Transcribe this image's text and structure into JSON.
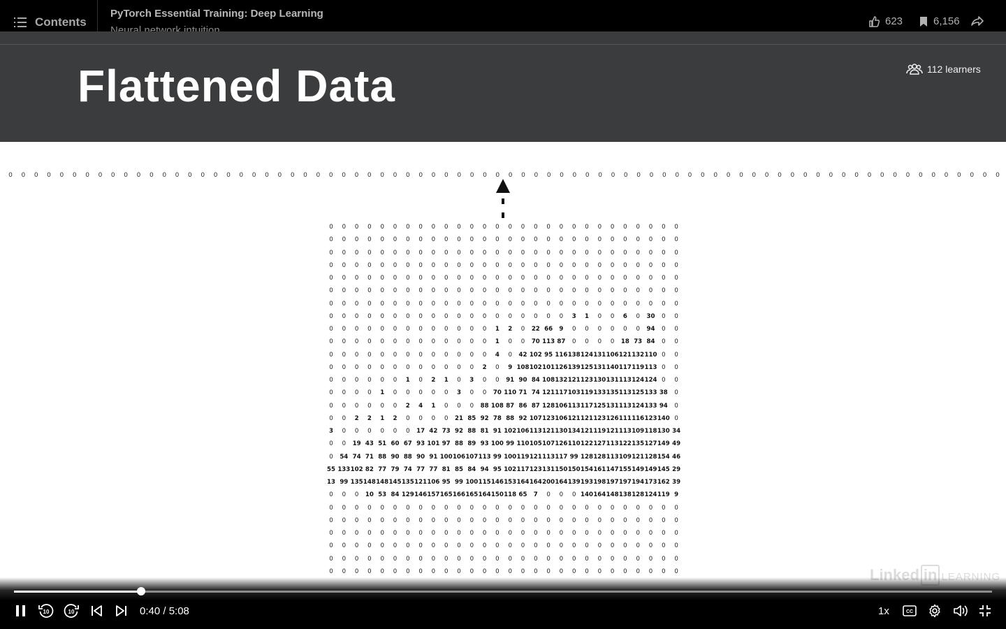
{
  "header": {
    "contents_label": "Contents",
    "course_title": "PyTorch Essential Training: Deep Learning",
    "lesson_title": "Neural network intuition",
    "likes": "623",
    "saves": "6,156"
  },
  "slide": {
    "title": "Flattened Data",
    "learners": "112 learners",
    "watermark_brand": "Linked",
    "watermark_in": "in",
    "watermark_learning": "LEARNING",
    "flattened_row": "0",
    "matrix": [
      [
        0,
        0,
        0,
        0,
        0,
        0,
        0,
        0,
        0,
        0,
        0,
        0,
        0,
        0,
        0,
        0,
        0,
        0,
        0,
        0,
        0,
        0,
        0,
        0,
        0,
        0,
        0,
        0
      ],
      [
        0,
        0,
        0,
        0,
        0,
        0,
        0,
        0,
        0,
        0,
        0,
        0,
        0,
        0,
        0,
        0,
        0,
        0,
        0,
        0,
        0,
        0,
        0,
        0,
        0,
        0,
        0,
        0
      ],
      [
        0,
        0,
        0,
        0,
        0,
        0,
        0,
        0,
        0,
        0,
        0,
        0,
        0,
        0,
        0,
        0,
        0,
        0,
        0,
        0,
        0,
        0,
        0,
        0,
        0,
        0,
        0,
        0
      ],
      [
        0,
        0,
        0,
        0,
        0,
        0,
        0,
        0,
        0,
        0,
        0,
        0,
        0,
        0,
        0,
        0,
        0,
        0,
        0,
        0,
        0,
        0,
        0,
        0,
        0,
        0,
        0,
        0
      ],
      [
        0,
        0,
        0,
        0,
        0,
        0,
        0,
        0,
        0,
        0,
        0,
        0,
        0,
        0,
        0,
        0,
        0,
        0,
        0,
        0,
        0,
        0,
        0,
        0,
        0,
        0,
        0,
        0
      ],
      [
        0,
        0,
        0,
        0,
        0,
        0,
        0,
        0,
        0,
        0,
        0,
        0,
        0,
        0,
        0,
        0,
        0,
        0,
        0,
        0,
        0,
        0,
        0,
        0,
        0,
        0,
        0,
        0
      ],
      [
        0,
        0,
        0,
        0,
        0,
        0,
        0,
        0,
        0,
        0,
        0,
        0,
        0,
        0,
        0,
        0,
        0,
        0,
        0,
        0,
        0,
        0,
        0,
        0,
        0,
        0,
        0,
        0
      ],
      [
        0,
        0,
        0,
        0,
        0,
        0,
        0,
        0,
        0,
        0,
        0,
        0,
        0,
        0,
        0,
        0,
        0,
        0,
        0,
        3,
        1,
        0,
        0,
        6,
        0,
        30,
        0,
        0
      ],
      [
        0,
        0,
        0,
        0,
        0,
        0,
        0,
        0,
        0,
        0,
        0,
        0,
        0,
        1,
        2,
        0,
        22,
        66,
        9,
        0,
        0,
        0,
        0,
        0,
        0,
        94,
        0,
        0
      ],
      [
        0,
        0,
        0,
        0,
        0,
        0,
        0,
        0,
        0,
        0,
        0,
        0,
        0,
        1,
        0,
        0,
        70,
        113,
        87,
        0,
        0,
        0,
        0,
        18,
        73,
        84,
        0,
        0
      ],
      [
        0,
        0,
        0,
        0,
        0,
        0,
        0,
        0,
        0,
        0,
        0,
        0,
        0,
        4,
        0,
        42,
        102,
        95,
        116,
        138,
        124,
        131,
        106,
        121,
        132,
        110,
        0,
        0
      ],
      [
        0,
        0,
        0,
        0,
        0,
        0,
        0,
        0,
        0,
        0,
        0,
        0,
        2,
        0,
        9,
        108,
        102,
        101,
        126,
        139,
        125,
        131,
        140,
        117,
        119,
        113,
        0,
        0
      ],
      [
        0,
        0,
        0,
        0,
        0,
        0,
        1,
        0,
        2,
        1,
        0,
        3,
        0,
        0,
        91,
        90,
        84,
        108,
        132,
        121,
        123,
        130,
        131,
        113,
        124,
        124,
        0,
        0
      ],
      [
        0,
        0,
        0,
        0,
        1,
        0,
        0,
        0,
        0,
        0,
        3,
        0,
        0,
        70,
        110,
        71,
        74,
        121,
        117,
        103,
        119,
        133,
        135,
        113,
        125,
        133,
        38,
        0
      ],
      [
        0,
        0,
        0,
        0,
        0,
        0,
        2,
        4,
        1,
        0,
        0,
        0,
        88,
        108,
        87,
        86,
        87,
        128,
        106,
        113,
        117,
        125,
        131,
        113,
        124,
        133,
        94,
        0
      ],
      [
        0,
        0,
        2,
        2,
        1,
        2,
        0,
        0,
        0,
        0,
        21,
        85,
        92,
        78,
        88,
        92,
        107,
        123,
        106,
        121,
        121,
        123,
        126,
        111,
        116,
        123,
        140,
        0
      ],
      [
        3,
        0,
        0,
        0,
        0,
        0,
        0,
        17,
        42,
        73,
        92,
        88,
        81,
        91,
        102,
        106,
        113,
        121,
        130,
        134,
        121,
        119,
        121,
        113,
        109,
        118,
        130,
        34
      ],
      [
        0,
        0,
        19,
        43,
        51,
        60,
        67,
        93,
        101,
        97,
        88,
        89,
        93,
        100,
        99,
        110,
        105,
        107,
        126,
        110,
        122,
        127,
        113,
        122,
        135,
        127,
        149,
        49
      ],
      [
        0,
        54,
        74,
        71,
        88,
        90,
        88,
        90,
        91,
        100,
        106,
        107,
        113,
        99,
        100,
        119,
        121,
        113,
        117,
        99,
        128,
        128,
        113,
        109,
        121,
        128,
        154,
        46
      ],
      [
        55,
        133,
        102,
        82,
        77,
        79,
        74,
        77,
        77,
        81,
        85,
        84,
        94,
        95,
        102,
        117,
        123,
        131,
        150,
        150,
        154,
        161,
        147,
        155,
        149,
        149,
        145,
        29
      ],
      [
        13,
        99,
        135,
        148,
        148,
        145,
        135,
        121,
        106,
        95,
        99,
        100,
        115,
        146,
        153,
        164,
        164,
        200,
        164,
        139,
        193,
        198,
        197,
        197,
        194,
        173,
        162,
        39
      ],
      [
        0,
        0,
        0,
        10,
        53,
        84,
        129,
        146,
        157,
        165,
        166,
        165,
        164,
        150,
        118,
        65,
        7,
        0,
        0,
        0,
        140,
        164,
        148,
        138,
        128,
        124,
        119,
        9
      ],
      [
        0,
        0,
        0,
        0,
        0,
        0,
        0,
        0,
        0,
        0,
        0,
        0,
        0,
        0,
        0,
        0,
        0,
        0,
        0,
        0,
        0,
        0,
        0,
        0,
        0,
        0,
        0,
        0
      ],
      [
        0,
        0,
        0,
        0,
        0,
        0,
        0,
        0,
        0,
        0,
        0,
        0,
        0,
        0,
        0,
        0,
        0,
        0,
        0,
        0,
        0,
        0,
        0,
        0,
        0,
        0,
        0,
        0
      ],
      [
        0,
        0,
        0,
        0,
        0,
        0,
        0,
        0,
        0,
        0,
        0,
        0,
        0,
        0,
        0,
        0,
        0,
        0,
        0,
        0,
        0,
        0,
        0,
        0,
        0,
        0,
        0,
        0
      ],
      [
        0,
        0,
        0,
        0,
        0,
        0,
        0,
        0,
        0,
        0,
        0,
        0,
        0,
        0,
        0,
        0,
        0,
        0,
        0,
        0,
        0,
        0,
        0,
        0,
        0,
        0,
        0,
        0
      ],
      [
        0,
        0,
        0,
        0,
        0,
        0,
        0,
        0,
        0,
        0,
        0,
        0,
        0,
        0,
        0,
        0,
        0,
        0,
        0,
        0,
        0,
        0,
        0,
        0,
        0,
        0,
        0,
        0
      ],
      [
        0,
        0,
        0,
        0,
        0,
        0,
        0,
        0,
        0,
        0,
        0,
        0,
        0,
        0,
        0,
        0,
        0,
        0,
        0,
        0,
        0,
        0,
        0,
        0,
        0,
        0,
        0,
        0
      ]
    ]
  },
  "player": {
    "time": "0:40 / 5:08",
    "progress_fraction": 0.1299,
    "speed": "1x",
    "icons": [
      "pause-icon",
      "rewind-10-icon",
      "forward-10-icon",
      "previous-icon",
      "next-icon",
      "captions-icon",
      "settings-icon",
      "volume-icon",
      "exit-fullscreen-icon"
    ]
  }
}
